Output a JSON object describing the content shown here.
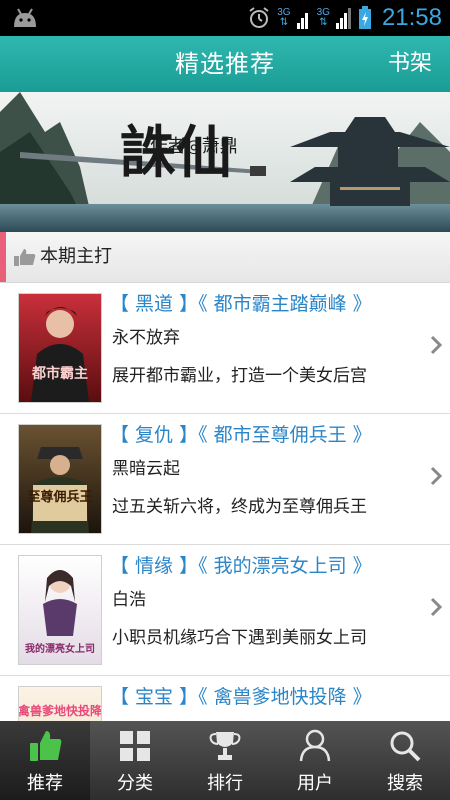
{
  "status_bar": {
    "network_1": "3G",
    "network_2": "3G",
    "time": "21:58"
  },
  "header": {
    "title": "精选推荐",
    "shelf_button": "书架"
  },
  "banner": {
    "title_art": "誅仙",
    "author_text": "作者◎萧鼎"
  },
  "section": {
    "title": "本期主打"
  },
  "books": [
    {
      "title": "【 黑道 】《 都市霸主踏巅峰 》",
      "author": "永不放弃",
      "desc": "展开都市霸业，打造一个美女后宫",
      "cover_text": "都市霸主",
      "cover_color": "#7a1418"
    },
    {
      "title": "【 复仇 】《 都市至尊佣兵王 》",
      "author": "黑暗云起",
      "desc": "过五关斩六将，终成为至尊佣兵王",
      "cover_text": "至尊佣兵王",
      "cover_color": "#3a2a1a"
    },
    {
      "title": "【 情缘 】《 我的漂亮女上司 》",
      "author": "白浩",
      "desc": "小职员机缘巧合下遇到美丽女上司",
      "cover_text": "我的漂亮女上司",
      "cover_color": "#e8dfe8"
    },
    {
      "title": "【 宝宝 】《 禽兽爹地快投降 》",
      "author": "",
      "desc": "",
      "cover_text": "禽兽爹地快投降",
      "cover_color": "#f3e6d6"
    }
  ],
  "nav": [
    {
      "label": "推荐",
      "icon": "thumbs-up-icon",
      "active": true
    },
    {
      "label": "分类",
      "icon": "grid-icon",
      "active": false
    },
    {
      "label": "排行",
      "icon": "trophy-icon",
      "active": false
    },
    {
      "label": "用户",
      "icon": "user-icon",
      "active": false
    },
    {
      "label": "搜索",
      "icon": "search-icon",
      "active": false
    }
  ],
  "colors": {
    "title_bar": "#1fa49d",
    "accent_blue": "#2b86c8",
    "active_icon": "#4cc24a",
    "section_mark": "#e8607a"
  }
}
